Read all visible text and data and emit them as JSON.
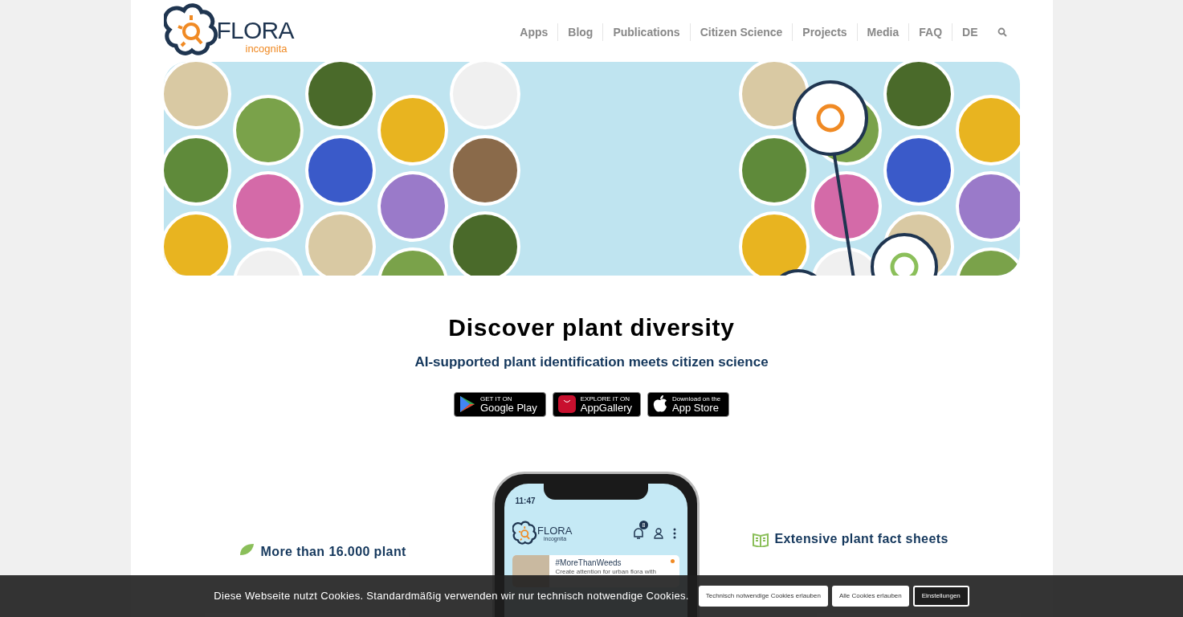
{
  "logo": {
    "name": "FLORA",
    "tagline": "incognita"
  },
  "nav": [
    {
      "label": "Apps"
    },
    {
      "label": "Blog"
    },
    {
      "label": "Publications"
    },
    {
      "label": "Citizen Science"
    },
    {
      "label": "Projects"
    },
    {
      "label": "Media"
    },
    {
      "label": "FAQ"
    },
    {
      "label": "DE"
    }
  ],
  "hero": {
    "title": "Discover plant diversity",
    "subtitle": "AI-supported plant identification meets citizen science"
  },
  "store_badges": [
    {
      "kind": "google",
      "small": "GET IT ON",
      "big": "Google Play"
    },
    {
      "kind": "huawei",
      "small": "EXPLORE IT ON",
      "big": "AppGallery"
    },
    {
      "kind": "apple",
      "small": "Download on the",
      "big": "App Store"
    }
  ],
  "phone": {
    "time": "11:47",
    "app_name": "FLORA",
    "app_tagline": "incognita",
    "notifications": "8",
    "card": {
      "title": "#MoreThanWeeds",
      "text": "Create attention for urban flora with"
    }
  },
  "features": [
    {
      "kind": "leaf",
      "title": "More than 16.000 plant"
    },
    {
      "kind": "book",
      "title": "Extensive plant fact sheets"
    }
  ],
  "cookie_bar": {
    "message": "Diese Webseite nutzt Cookies. Standardmäßig verwenden wir nur technisch notwendige Cookies.",
    "buttons": [
      {
        "label": "Technisch notwendige Cookies erlauben",
        "kind": "light"
      },
      {
        "label": "Alle Cookies erlauben",
        "kind": "light"
      },
      {
        "label": "Einstellungen",
        "kind": "dark"
      }
    ]
  }
}
